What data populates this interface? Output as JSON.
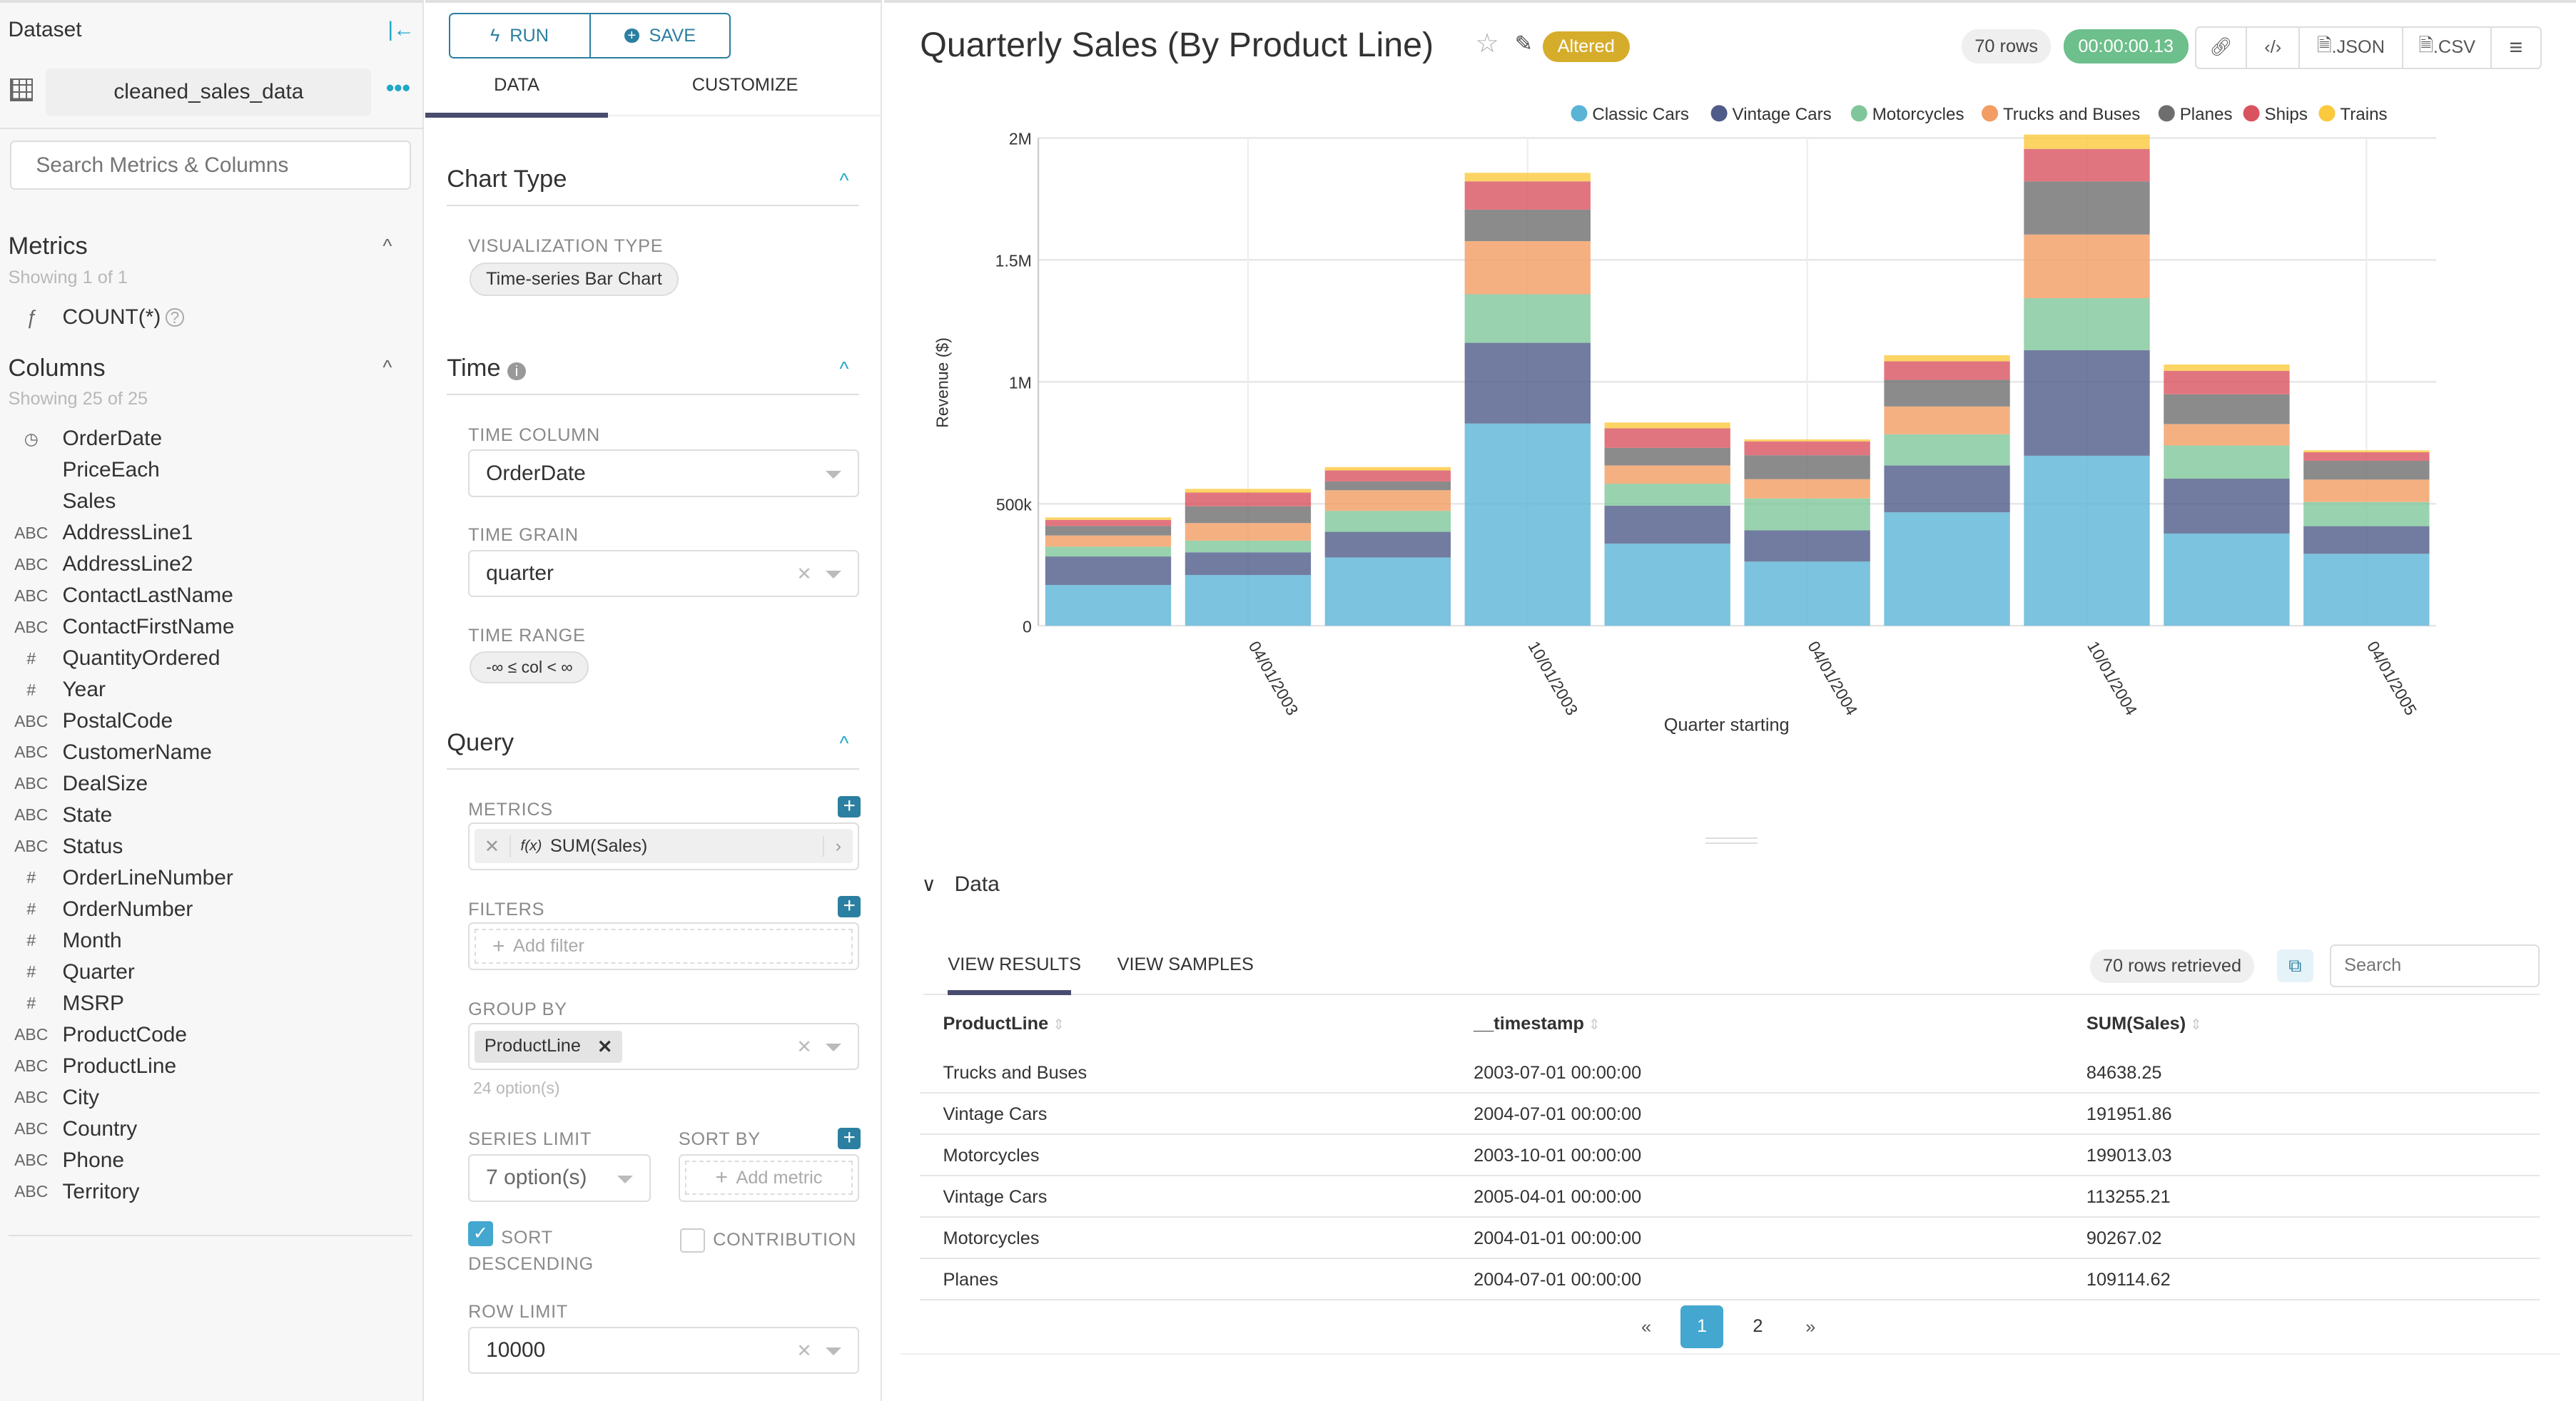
{
  "left": {
    "title": "Dataset",
    "dataset_name": "cleaned_sales_data",
    "search_placeholder": "Search Metrics & Columns",
    "metrics_title": "Metrics",
    "metrics_count": "Showing 1 of 1",
    "metrics": [
      {
        "type": "ƒ",
        "name": "COUNT(*)"
      }
    ],
    "columns_title": "Columns",
    "columns_count": "Showing 25 of 25",
    "columns": [
      {
        "type": "clock",
        "name": "OrderDate"
      },
      {
        "type": "",
        "name": "PriceEach"
      },
      {
        "type": "",
        "name": "Sales"
      },
      {
        "type": "ABC",
        "name": "AddressLine1"
      },
      {
        "type": "ABC",
        "name": "AddressLine2"
      },
      {
        "type": "ABC",
        "name": "ContactLastName"
      },
      {
        "type": "ABC",
        "name": "ContactFirstName"
      },
      {
        "type": "#",
        "name": "QuantityOrdered"
      },
      {
        "type": "#",
        "name": "Year"
      },
      {
        "type": "ABC",
        "name": "PostalCode"
      },
      {
        "type": "ABC",
        "name": "CustomerName"
      },
      {
        "type": "ABC",
        "name": "DealSize"
      },
      {
        "type": "ABC",
        "name": "State"
      },
      {
        "type": "ABC",
        "name": "Status"
      },
      {
        "type": "#",
        "name": "OrderLineNumber"
      },
      {
        "type": "#",
        "name": "OrderNumber"
      },
      {
        "type": "#",
        "name": "Month"
      },
      {
        "type": "#",
        "name": "Quarter"
      },
      {
        "type": "#",
        "name": "MSRP"
      },
      {
        "type": "ABC",
        "name": "ProductCode"
      },
      {
        "type": "ABC",
        "name": "ProductLine"
      },
      {
        "type": "ABC",
        "name": "City"
      },
      {
        "type": "ABC",
        "name": "Country"
      },
      {
        "type": "ABC",
        "name": "Phone"
      },
      {
        "type": "ABC",
        "name": "Territory"
      }
    ]
  },
  "mid": {
    "run": "RUN",
    "save": "SAVE",
    "tabs": [
      "DATA",
      "CUSTOMIZE"
    ],
    "chart_type": {
      "title": "Chart Type",
      "viz_label": "VISUALIZATION TYPE",
      "viz_value": "Time-series Bar Chart"
    },
    "time": {
      "title": "Time",
      "col_label": "TIME COLUMN",
      "col_value": "OrderDate",
      "grain_label": "TIME GRAIN",
      "grain_value": "quarter",
      "range_label": "TIME RANGE",
      "range_value": "-∞ ≤ col < ∞"
    },
    "query": {
      "title": "Query",
      "metrics_label": "METRICS",
      "metric_value": "SUM(Sales)",
      "metric_fx": "f(x)",
      "filters_label": "FILTERS",
      "add_filter": "Add filter",
      "groupby_label": "GROUP BY",
      "groupby_value": "ProductLine",
      "groupby_hint": "24 option(s)",
      "series_limit_label": "SERIES LIMIT",
      "series_limit_value": "7 option(s)",
      "sortby_label": "SORT BY",
      "add_metric": "Add metric",
      "sort_desc_label": "SORT DESCENDING",
      "sort_desc_checked": true,
      "contribution_label": "CONTRIBUTION",
      "contribution_checked": false,
      "row_limit_label": "ROW LIMIT",
      "row_limit_value": "10000"
    }
  },
  "header": {
    "title": "Quarterly Sales (By Product Line)",
    "altered": "Altered",
    "rows": "70 rows",
    "duration": "00:00:00.13",
    "json": ".JSON",
    "csv": ".CSV"
  },
  "chart_data": {
    "type": "bar",
    "stacked": true,
    "xlabel": "Quarter starting",
    "ylabel": "Revenue ($)",
    "ylim": [
      0,
      2000000
    ],
    "yticks": [
      {
        "v": 0,
        "label": "0"
      },
      {
        "v": 500000,
        "label": "500k"
      },
      {
        "v": 1000000,
        "label": "1M"
      },
      {
        "v": 1500000,
        "label": "1.5M"
      },
      {
        "v": 2000000,
        "label": "2M"
      }
    ],
    "categories": [
      "2003-01-01",
      "2003-04-01",
      "2003-07-01",
      "2003-10-01",
      "2004-01-01",
      "2004-04-01",
      "2004-07-01",
      "2004-10-01",
      "2005-01-01",
      "2005-04-01"
    ],
    "xticks": [
      {
        "index": 1,
        "label": "04/01/2003"
      },
      {
        "index": 3,
        "label": "10/01/2003"
      },
      {
        "index": 5,
        "label": "04/01/2004"
      },
      {
        "index": 7,
        "label": "10/01/2004"
      },
      {
        "index": 9,
        "label": "04/01/2005"
      }
    ],
    "legend_position": "top-right",
    "grid": true,
    "series": [
      {
        "name": "Classic Cars",
        "color": "#5ab4d6",
        "values": [
          167000,
          208000,
          280000,
          829000,
          337000,
          263000,
          465000,
          697000,
          378000,
          295000
        ]
      },
      {
        "name": "Vintage Cars",
        "color": "#4f5b88",
        "values": [
          117000,
          93000,
          105000,
          331000,
          155000,
          128000,
          191951.86,
          433000,
          225000,
          113255.21
        ]
      },
      {
        "name": "Motorcycles",
        "color": "#7fc79a",
        "values": [
          40000,
          48000,
          86000,
          199013.03,
          90267.02,
          131000,
          128000,
          213000,
          136000,
          99000
        ]
      },
      {
        "name": "Trucks and Buses",
        "color": "#f39c63",
        "values": [
          46000,
          72000,
          84638.25,
          218000,
          75000,
          79000,
          114000,
          261000,
          88000,
          92000
        ]
      },
      {
        "name": "Planes",
        "color": "#6e6e6e",
        "values": [
          39000,
          69000,
          36000,
          129000,
          72000,
          98000,
          109114.62,
          218000,
          122000,
          77000
        ]
      },
      {
        "name": "Ships",
        "color": "#d9535f",
        "values": [
          25000,
          56000,
          45000,
          116000,
          80000,
          57000,
          76000,
          133000,
          96000,
          35000
        ]
      },
      {
        "name": "Trains",
        "color": "#fbc93d",
        "values": [
          10000,
          15000,
          14000,
          35000,
          24000,
          8000,
          25000,
          59000,
          26000,
          8000
        ]
      }
    ]
  },
  "data_pane": {
    "title": "Data",
    "tabs": [
      "VIEW RESULTS",
      "VIEW SAMPLES"
    ],
    "rows_retrieved": "70 rows retrieved",
    "search_placeholder": "Search",
    "columns": [
      "ProductLine",
      "__timestamp",
      "SUM(Sales)"
    ],
    "rows": [
      [
        "Trucks and Buses",
        "2003-07-01 00:00:00",
        "84638.25"
      ],
      [
        "Vintage Cars",
        "2004-07-01 00:00:00",
        "191951.86"
      ],
      [
        "Motorcycles",
        "2003-10-01 00:00:00",
        "199013.03"
      ],
      [
        "Vintage Cars",
        "2005-04-01 00:00:00",
        "113255.21"
      ],
      [
        "Motorcycles",
        "2004-01-01 00:00:00",
        "90267.02"
      ],
      [
        "Planes",
        "2004-07-01 00:00:00",
        "109114.62"
      ]
    ],
    "pagination": {
      "prev": "«",
      "pages": [
        "1",
        "2"
      ],
      "current": "1",
      "next": "»"
    }
  }
}
